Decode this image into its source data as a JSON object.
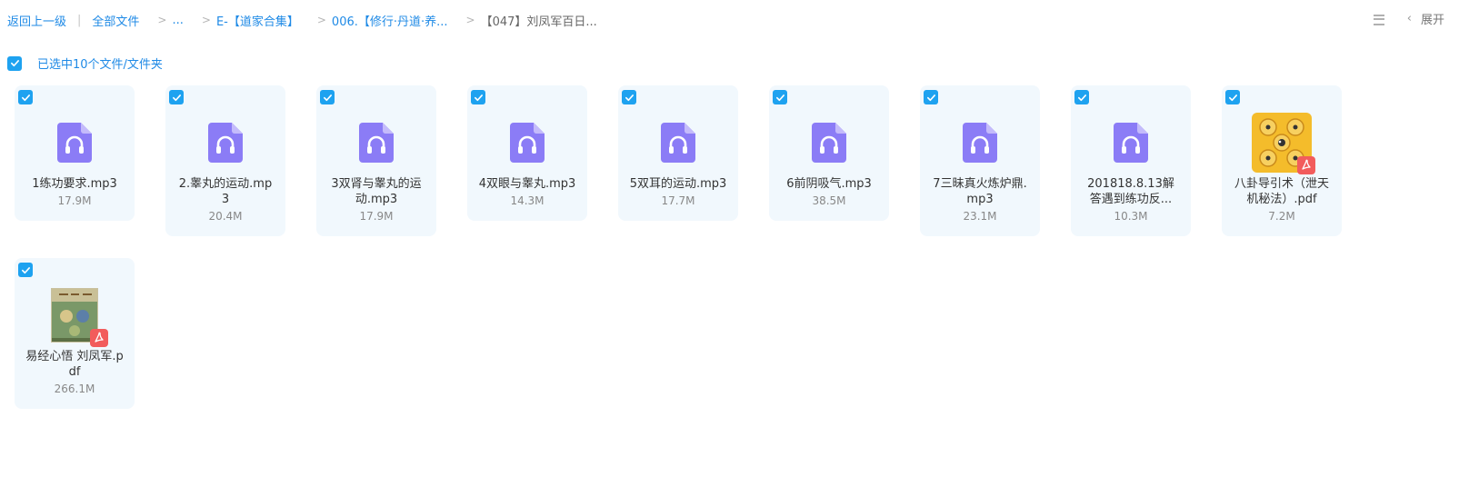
{
  "breadcrumb": {
    "back": "返回上一级",
    "all_files": "全部文件",
    "ellipsis": "...",
    "folder1": "E-【道家合集】",
    "folder2": "006.【修行·丹道·养...",
    "current": "【047】刘凤军百日...",
    "separator": ">"
  },
  "top_right": {
    "expand_label": "展开",
    "expand_chevron": "‹"
  },
  "selection": {
    "label": "已选中10个文件/文件夹",
    "checked": true
  },
  "files": [
    {
      "name": "1练功要求.mp3",
      "size": "17.9M",
      "type": "audio",
      "checked": true
    },
    {
      "name": "2.睾丸的运动.mp3",
      "size": "20.4M",
      "type": "audio",
      "checked": true
    },
    {
      "name": "3双肾与睾丸的运动.mp3",
      "size": "17.9M",
      "type": "audio",
      "checked": true
    },
    {
      "name": "4双眼与睾丸.mp3",
      "size": "14.3M",
      "type": "audio",
      "checked": true
    },
    {
      "name": "5双耳的运动.mp3",
      "size": "17.7M",
      "type": "audio",
      "checked": true
    },
    {
      "name": "6前阴吸气.mp3",
      "size": "38.5M",
      "type": "audio",
      "checked": true
    },
    {
      "name": "7三昧真火炼炉鼎.mp3",
      "size": "23.1M",
      "type": "audio",
      "checked": true
    },
    {
      "name": "201818.8.13解答遇到练功反...",
      "size": "10.3M",
      "type": "audio",
      "checked": true
    },
    {
      "name": "八卦导引术（泄天机秘法）.pdf",
      "size": "7.2M",
      "type": "pdf-image",
      "checked": true
    },
    {
      "name": "易经心悟 刘凤军.pdf",
      "size": "266.1M",
      "type": "pdf-book",
      "checked": true
    }
  ],
  "colors": {
    "accent": "#1ea2f0",
    "link": "#1f8ae6",
    "audio_icon": "#8b7cf6",
    "card_bg": "#f1f8fd",
    "pdf_red": "#f25c5c"
  }
}
